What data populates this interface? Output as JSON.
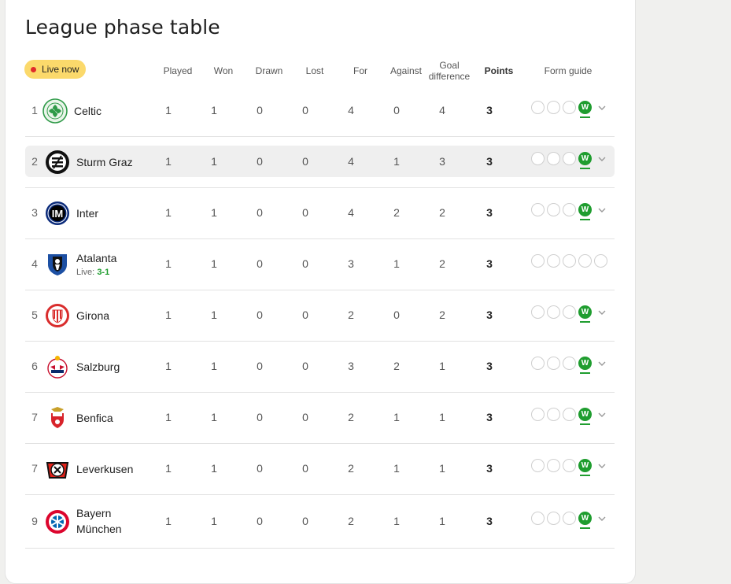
{
  "title": "League phase table",
  "live_badge": "Live now",
  "columns": {
    "played": "Played",
    "won": "Won",
    "drawn": "Drawn",
    "lost": "Lost",
    "for": "For",
    "against": "Against",
    "goal_diff_1": "Goal",
    "goal_diff_2": "difference",
    "points": "Points",
    "form": "Form guide"
  },
  "form_win_letter": "W",
  "colors": {
    "live_badge_bg": "#fbd96b",
    "live_dot": "#e02b2b",
    "win": "#1f9d2f",
    "highlight_row": "#efefef"
  },
  "rows": [
    {
      "rank": "1",
      "team": "Celtic",
      "played": "1",
      "won": "1",
      "drawn": "0",
      "lost": "0",
      "for": "4",
      "against": "0",
      "gd": "4",
      "points": "3",
      "crest": "celtic-crest",
      "form": [
        "",
        "",
        "",
        "W"
      ]
    },
    {
      "rank": "2",
      "team": "Sturm Graz",
      "played": "1",
      "won": "1",
      "drawn": "0",
      "lost": "0",
      "for": "4",
      "against": "1",
      "gd": "3",
      "points": "3",
      "crest": "sturm-graz-crest",
      "form": [
        "",
        "",
        "",
        "W"
      ]
    },
    {
      "rank": "3",
      "team": "Inter",
      "played": "1",
      "won": "1",
      "drawn": "0",
      "lost": "0",
      "for": "4",
      "against": "2",
      "gd": "2",
      "points": "3",
      "crest": "inter-crest",
      "form": [
        "",
        "",
        "",
        "W"
      ]
    },
    {
      "rank": "4",
      "team": "Atalanta",
      "live_label": "Live:",
      "live_score": "3-1",
      "played": "1",
      "won": "1",
      "drawn": "0",
      "lost": "0",
      "for": "3",
      "against": "1",
      "gd": "2",
      "points": "3",
      "crest": "atalanta-crest",
      "form": [
        "",
        "",
        "",
        "",
        ""
      ]
    },
    {
      "rank": "5",
      "team": "Girona",
      "played": "1",
      "won": "1",
      "drawn": "0",
      "lost": "0",
      "for": "2",
      "against": "0",
      "gd": "2",
      "points": "3",
      "crest": "girona-crest",
      "form": [
        "",
        "",
        "",
        "W"
      ]
    },
    {
      "rank": "6",
      "team": "Salzburg",
      "played": "1",
      "won": "1",
      "drawn": "0",
      "lost": "0",
      "for": "3",
      "against": "2",
      "gd": "1",
      "points": "3",
      "crest": "salzburg-crest",
      "form": [
        "",
        "",
        "",
        "W"
      ]
    },
    {
      "rank": "7",
      "team": "Benfica",
      "played": "1",
      "won": "1",
      "drawn": "0",
      "lost": "0",
      "for": "2",
      "against": "1",
      "gd": "1",
      "points": "3",
      "crest": "benfica-crest",
      "form": [
        "",
        "",
        "",
        "W"
      ]
    },
    {
      "rank": "7",
      "team": "Leverkusen",
      "played": "1",
      "won": "1",
      "drawn": "0",
      "lost": "0",
      "for": "2",
      "against": "1",
      "gd": "1",
      "points": "3",
      "crest": "leverkusen-crest",
      "form": [
        "",
        "",
        "",
        "W"
      ]
    },
    {
      "rank": "9",
      "team": "Bayern",
      "team_line2": "München",
      "played": "1",
      "won": "1",
      "drawn": "0",
      "lost": "0",
      "for": "2",
      "against": "1",
      "gd": "1",
      "points": "3",
      "crest": "bayern-crest",
      "form": [
        "",
        "",
        "",
        "W"
      ]
    }
  ]
}
